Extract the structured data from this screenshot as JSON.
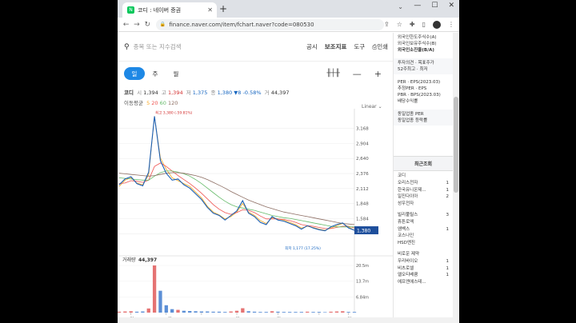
{
  "browser": {
    "tab_title": "코디 : 네이버 증권",
    "favicon": "N",
    "url": "finance.naver.com/item/fchart.naver?code=080530"
  },
  "search": {
    "placeholder": "종목 또는 지수검색"
  },
  "top_menu": [
    "공시",
    "보조지표",
    "도구",
    "인쇄"
  ],
  "periods": [
    "일",
    "주",
    "월"
  ],
  "active_period": "일",
  "stock": {
    "name": "코디",
    "open_label": "시",
    "open": "1,394",
    "high_label": "고",
    "high": "1,394",
    "low_label": "저",
    "low": "1,375",
    "close_label": "종",
    "close": "1,380",
    "change": "▼8",
    "change_pct": "-0.58%",
    "volume_label": "거",
    "volume": "44,397"
  },
  "moving_avg": {
    "label": "이동평균",
    "periods": [
      "5",
      "20",
      "60",
      "120"
    ]
  },
  "scale_mode": "Linear",
  "chart_data": {
    "type": "line",
    "x_ticks": [
      "6월",
      "10월",
      "2022",
      "4월",
      "8월",
      "2023",
      "4월"
    ],
    "price_ticks": [
      3168,
      2904,
      2640,
      2376,
      2112,
      1848,
      1584,
      1320
    ],
    "price_tick_labels": [
      "3,168",
      "2,904",
      "2,640",
      "2,376",
      "2,112",
      "1,848",
      "1,584"
    ],
    "ylim": [
      1100,
      3400
    ],
    "current_price": "1,380",
    "max_label": "최고 3,380 (-59.81%)",
    "min_label": "최저 1,177 (17.25%)",
    "series": [
      {
        "name": "5",
        "color": "#f9a825",
        "values": [
          2150,
          2260,
          2300,
          2210,
          2180,
          2350,
          3380,
          2650,
          2450,
          2300,
          2250,
          2200,
          2150,
          2050,
          1950,
          1800,
          1700,
          1650,
          1580,
          1620,
          1700,
          1850,
          1700,
          1640,
          1550,
          1500,
          1600,
          1580,
          1560,
          1520,
          1480,
          1420,
          1450,
          1430,
          1400,
          1380,
          1420,
          1460,
          1500,
          1440,
          1380
        ]
      },
      {
        "name": "20",
        "color": "#ef5350",
        "values": [
          2200,
          2210,
          2250,
          2240,
          2220,
          2260,
          2500,
          2560,
          2500,
          2420,
          2340,
          2270,
          2200,
          2120,
          2030,
          1930,
          1830,
          1750,
          1690,
          1660,
          1690,
          1740,
          1730,
          1690,
          1630,
          1580,
          1580,
          1580,
          1570,
          1550,
          1520,
          1480,
          1460,
          1450,
          1430,
          1410,
          1410,
          1430,
          1450,
          1450,
          1420
        ]
      },
      {
        "name": "60",
        "color": "#66bb6a",
        "values": [
          2300,
          2290,
          2280,
          2270,
          2260,
          2260,
          2330,
          2390,
          2420,
          2420,
          2400,
          2370,
          2330,
          2270,
          2200,
          2120,
          2040,
          1960,
          1890,
          1830,
          1790,
          1770,
          1750,
          1730,
          1700,
          1670,
          1640,
          1620,
          1600,
          1590,
          1570,
          1550,
          1530,
          1510,
          1490,
          1470,
          1450,
          1440,
          1440,
          1440,
          1440
        ]
      },
      {
        "name": "120",
        "color": "#8d6e63",
        "values": [
          2380,
          2370,
          2360,
          2350,
          2340,
          2330,
          2340,
          2360,
          2380,
          2390,
          2390,
          2380,
          2360,
          2340,
          2310,
          2270,
          2220,
          2170,
          2120,
          2060,
          2010,
          1960,
          1910,
          1870,
          1830,
          1790,
          1760,
          1730,
          1700,
          1680,
          1660,
          1640,
          1620,
          1600,
          1580,
          1560,
          1540,
          1520,
          1500,
          1490,
          1480
        ]
      },
      {
        "name": "price",
        "color": "#1a5fb4",
        "values": [
          2180,
          2280,
          2320,
          2200,
          2160,
          2400,
          3380,
          2600,
          2380,
          2260,
          2280,
          2180,
          2120,
          2020,
          1920,
          1780,
          1680,
          1640,
          1560,
          1640,
          1720,
          1900,
          1680,
          1620,
          1520,
          1480,
          1620,
          1560,
          1540,
          1500,
          1460,
          1400,
          1460,
          1420,
          1390,
          1370,
          1440,
          1480,
          1510,
          1420,
          1380
        ]
      }
    ],
    "volume_label": "거래량",
    "volume_value": "44,397",
    "volume_ticks": [
      "20.5m",
      "13.7m",
      "6.84m"
    ],
    "volume_max": 20.5,
    "volume": [
      0.4,
      0.5,
      0.6,
      0.4,
      0.5,
      1.8,
      20.5,
      9.5,
      3.2,
      1.5,
      1.2,
      0.8,
      0.7,
      0.6,
      0.5,
      0.5,
      0.4,
      0.4,
      0.3,
      0.5,
      0.8,
      1.9,
      0.6,
      0.4,
      0.3,
      0.3,
      0.6,
      0.4,
      0.3,
      0.3,
      0.3,
      0.3,
      0.4,
      0.3,
      0.3,
      0.2,
      0.4,
      0.5,
      0.6,
      0.3,
      0.3
    ]
  },
  "sidebar": {
    "top_links": [
      "외국인한도주식수(A)",
      "외국인보유주식수(B)",
      "외국인소진율(B/A)"
    ],
    "invest": [
      "투자의견",
      "목표주가",
      "52주최고",
      "최저"
    ],
    "per": [
      "PER",
      "EPS(2023.03)",
      "추정PER",
      "EPS",
      "PBR",
      "BPS(2023.03)",
      "배당수익률"
    ],
    "industry": [
      "동일업종 PER",
      "동일업종 등락률"
    ],
    "recent_title": "최근조회",
    "recent": [
      {
        "name": "코디",
        "n": ""
      },
      {
        "name": "오리스전자",
        "n": "1"
      },
      {
        "name": "한국유니온제...",
        "n": "1"
      },
      {
        "name": "일진다이아",
        "n": "2"
      },
      {
        "name": "성우전자",
        "n": ""
      },
      {
        "name": "",
        "n": ""
      },
      {
        "name": "빌리풀릴스",
        "n": "3"
      },
      {
        "name": "휴튼로엑",
        "n": ""
      },
      {
        "name": "엠벡스",
        "n": "1"
      },
      {
        "name": "코스나인",
        "n": ""
      },
      {
        "name": "HSD엔진",
        "n": ""
      },
      {
        "name": "",
        "n": ""
      },
      {
        "name": "비로운 제약",
        "n": ""
      },
      {
        "name": "우리바이오",
        "n": "1"
      },
      {
        "name": "비츠로셀",
        "n": "1"
      },
      {
        "name": "엘오티베큠",
        "n": "1"
      },
      {
        "name": "에프엔에스테...",
        "n": ""
      }
    ]
  }
}
